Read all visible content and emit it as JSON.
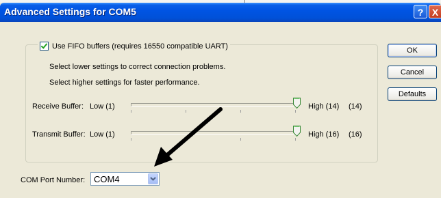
{
  "window": {
    "title": "Advanced Settings for COM5",
    "help_button": "?",
    "close_button": "X"
  },
  "fifo": {
    "checked": true,
    "label": "Use FIFO buffers (requires 16550 compatible UART)"
  },
  "hints": [
    "Select lower settings to correct connection problems.",
    "Select higher settings for faster performance."
  ],
  "receive": {
    "label": "Receive Buffer:",
    "low_label": "Low (1)",
    "high_label": "High (14)",
    "value_text": "(14)",
    "level": 1.0
  },
  "transmit": {
    "label": "Transmit Buffer:",
    "low_label": "Low (1)",
    "high_label": "High (16)",
    "value_text": "(16)",
    "level": 1.0
  },
  "buttons": {
    "ok": "OK",
    "cancel": "Cancel",
    "defaults": "Defaults"
  },
  "com_port": {
    "label": "COM Port Number:",
    "selected": "COM4"
  },
  "colors": {
    "titlebar": "#0054e3",
    "dialog_bg": "#ece9d8",
    "arrow": "#000000"
  }
}
